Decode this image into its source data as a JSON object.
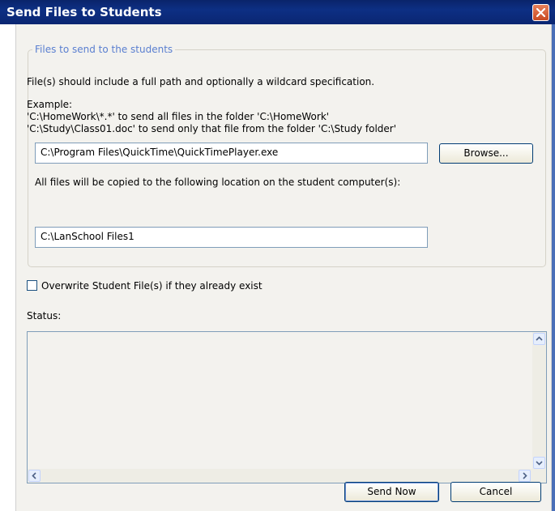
{
  "window": {
    "title": "Send Files to Students"
  },
  "group": {
    "legend": "Files to send to the students",
    "instruction": "File(s) should include a full path and optionally a wildcard specification.",
    "example_heading": "Example:",
    "example_line1": "'C:\\HomeWork\\*.*' to send all files in the folder 'C:\\HomeWork'",
    "example_line2": "'C:\\Study\\Class01.doc' to send only that file from the folder 'C:\\Study folder'",
    "file_path_value": "C:\\Program Files\\QuickTime\\QuickTimePlayer.exe",
    "browse_label": "Browse...",
    "destination_label": "All files will be copied to the following location on the student computer(s):",
    "destination_value": "C:\\LanSchool Files1"
  },
  "overwrite": {
    "label": "Overwrite Student File(s) if they already exist",
    "checked": false
  },
  "status": {
    "label": "Status:",
    "content": ""
  },
  "buttons": {
    "send_now": "Send Now",
    "cancel": "Cancel"
  },
  "colors": {
    "titlebar": "#0a246a",
    "close": "#d9582b",
    "legend": "#5a7fd0",
    "dialog_bg": "#f3f2ee"
  },
  "icons": [
    "close-icon",
    "scroll-up-icon",
    "scroll-down-icon",
    "scroll-left-icon",
    "scroll-right-icon"
  ]
}
